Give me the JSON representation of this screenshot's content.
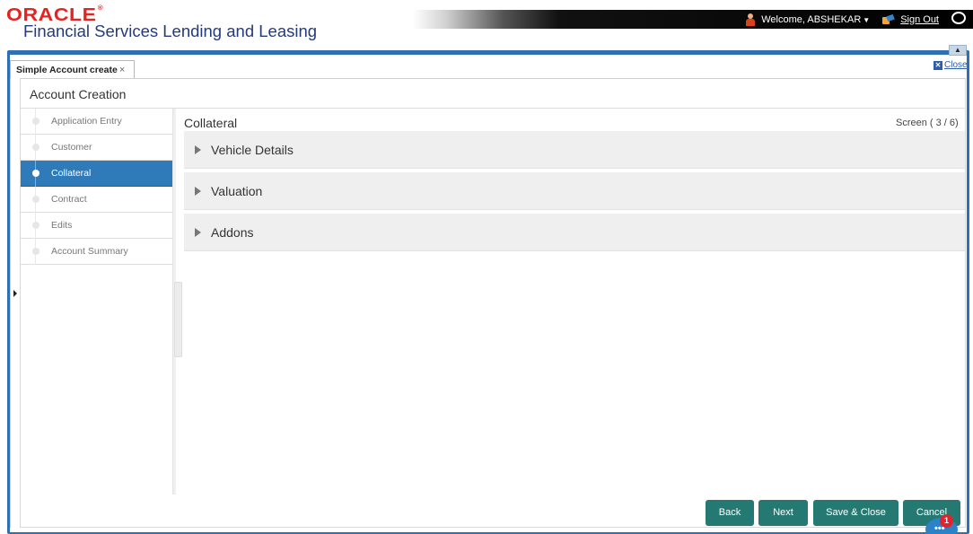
{
  "brand": {
    "logo": "ORACLE",
    "product": "Financial Services Lending and Leasing"
  },
  "user": {
    "welcome": "Welcome, ABSHEKAR",
    "sign_out": "Sign Out"
  },
  "tab": {
    "label": "Simple Account create",
    "close_glyph": "×"
  },
  "window_close": "Close",
  "page_title": "Account Creation",
  "steps": [
    {
      "label": "Application Entry",
      "active": false
    },
    {
      "label": "Customer",
      "active": false
    },
    {
      "label": "Collateral",
      "active": true
    },
    {
      "label": "Contract",
      "active": false
    },
    {
      "label": "Edits",
      "active": false
    },
    {
      "label": "Account Summary",
      "active": false
    }
  ],
  "section": {
    "title": "Collateral",
    "screen_indicator": "Screen ( 3 / 6)"
  },
  "accordions": [
    {
      "label": "Vehicle Details"
    },
    {
      "label": "Valuation"
    },
    {
      "label": "Addons"
    }
  ],
  "buttons": {
    "back": "Back",
    "next": "Next",
    "save_close": "Save & Close",
    "cancel": "Cancel"
  },
  "chat": {
    "badge_count": "1"
  },
  "colors": {
    "brand_red": "#e8231f",
    "brand_blue": "#243a7c",
    "frame_blue": "#2f6fb4",
    "active_step": "#2f7ab8",
    "button_teal": "#247a72"
  }
}
